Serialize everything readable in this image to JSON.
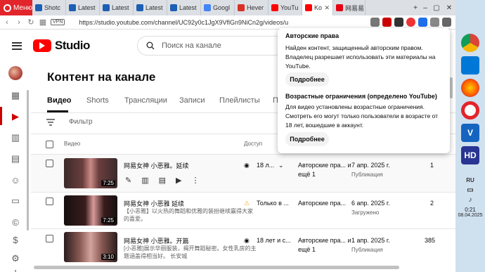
{
  "browser": {
    "menu_label": "Меню",
    "tabs": [
      {
        "label": "Shotc",
        "color": "#1c5fb4"
      },
      {
        "label": "Latest",
        "color": "#1c5fb4"
      },
      {
        "label": "Latest",
        "color": "#1c5fb4"
      },
      {
        "label": "Latest",
        "color": "#1c5fb4"
      },
      {
        "label": "Latest",
        "color": "#1c5fb4"
      },
      {
        "label": "Googl",
        "color": "#4285f4"
      },
      {
        "label": "Hever",
        "color": "#d93025"
      },
      {
        "label": "YouTu",
        "color": "#ff0000"
      },
      {
        "label": "Ko",
        "color": "#ff0000"
      },
      {
        "label": "网易易",
        "color": "#e60012"
      }
    ],
    "vpn_label": "VPN",
    "url": "https://studio.youtube.com/channel/UC92y0c1JgX9VflGn9NiCn2g/videos/u"
  },
  "header": {
    "logo_text": "Studio",
    "search_placeholder": "Поиск на канале"
  },
  "main": {
    "title": "Контент на канале",
    "tabs": [
      "Видео",
      "Shorts",
      "Трансляции",
      "Записи",
      "Плейлисты",
      "П"
    ],
    "filter_label": "Фильтр",
    "columns": {
      "video": "Видео",
      "access": "Доступ"
    }
  },
  "rows": [
    {
      "title": "网易女神 小恶雅。延续",
      "description": "",
      "duration": "7:25",
      "access": "18 л...",
      "restrictions": "Авторские пра... и ещё 1",
      "date": "7 апр. 2025 г.",
      "date_status": "Публикация",
      "views": "1"
    },
    {
      "title": "网易女神 小恶雅 延续",
      "description": "【小恶雅】以火热的舞蹈和优雅的装扮继续赢得大家的喜爱。",
      "duration": "7:25",
      "access": "Только в ...",
      "restrictions": "Авторские пра...",
      "date": "6 апр. 2025 г.",
      "date_status": "Загружено",
      "views": "2"
    },
    {
      "title": "网易女神 小恶雅。开篇",
      "description": "[小恶雅]展示华丽服装，揭开舞蹈秘密。女性乳房的主题涵盖得相当好。 长安城",
      "duration": "3:10",
      "access": "18 лет и с...",
      "restrictions": "Авторские пра... и ещё 1",
      "date": "1 апр. 2025 г.",
      "date_status": "Публикация",
      "views": "385"
    }
  ],
  "popup": {
    "copyright_heading": "Авторские права",
    "copyright_text": "Найден контент, защищенный авторским правом. Владелец разрешает использовать эти материалы на YouTube.",
    "copyright_button": "Подробнее",
    "age_heading": "Возрастные ограничения (определено YouTube)",
    "age_text": "Для видео установлены возрастные ограничения. Смотреть его могут только пользователи в возрасте от 18 лет, вошедшие в аккаунт.",
    "age_button": "Подробнее"
  },
  "taskbar": {
    "lang": "RU",
    "time": "0:21",
    "date": "08.04.2025"
  }
}
